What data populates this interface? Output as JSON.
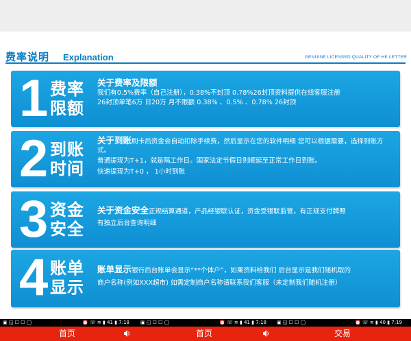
{
  "header": {
    "title_zh": "费率说明",
    "title_en": "Explanation",
    "title_right": "GENUINE LICENSED QUALITY OF HE LETTER"
  },
  "panels": [
    {
      "number": "1",
      "label_line1": "费率",
      "label_line2": "限额",
      "heading": "关于费率及限额",
      "lines": [
        "我们有0.5%费率（自己注册），0.38%不封顶 0.78%26封顶资料提供在线客服注册",
        "26封顶单笔6万 日20万  月不限额     0.38%  、0.5%  、0.78% 26封顶"
      ]
    },
    {
      "number": "2",
      "label_line1": "到账",
      "label_line2": "时间",
      "heading": "关于到账",
      "heading_tail": "刷卡后资金会自动扣除手续费，然后显示在您的软件明细 您可以根据需要，选择到账方式。",
      "lines": [
        "普通提现为T+1，就是隔工作日。国家法定节假日则顺延至正常工作日到账。",
        "快速提现为T+0 ，  1小时到账"
      ]
    },
    {
      "number": "3",
      "label_line1": "资金",
      "label_line2": "安全",
      "heading": "关于资金安全",
      "heading_tail": "正规结算通道，产品经银联认证，资金受银联监管，有正规支付牌照",
      "lines": [
        "有独立后台查询明细"
      ]
    },
    {
      "number": "4",
      "label_line1": "账单",
      "label_line2": "显示",
      "heading": "账单显示",
      "heading_tail": "银行后台账单会显示“**个体户”，如果资料给我们  后台显示是我们随机取的",
      "lines": [
        "商户名称(例如XXX超市) 如需定制商户名称请联系我们客服（未定制我们随机注册）"
      ]
    }
  ],
  "statusbar": {
    "seg1_left": "▣ ◱ ☐ ☐ ◯",
    "seg1_right": "⏰ ☏ ≋ ▮ 41 ▮ 7:18",
    "seg2_left": "▣ ◱ ☐ ☐ ◯",
    "seg2_right": "⏰ ☏ ≋ ▮ 41 ▮ 7:18",
    "seg3_left": "▣ ◱ ☐ ☐ ◯",
    "seg3_right": "⏰ ☏ ≋ ▮ 40 ▮ 7:19"
  },
  "navbar": {
    "item1": "首页",
    "item2": "首页",
    "item3": "交易"
  },
  "colors": {
    "accent_blue": "#0a7cc1",
    "panel_blue": "#1592d6",
    "nav_red": "#e8240f"
  }
}
